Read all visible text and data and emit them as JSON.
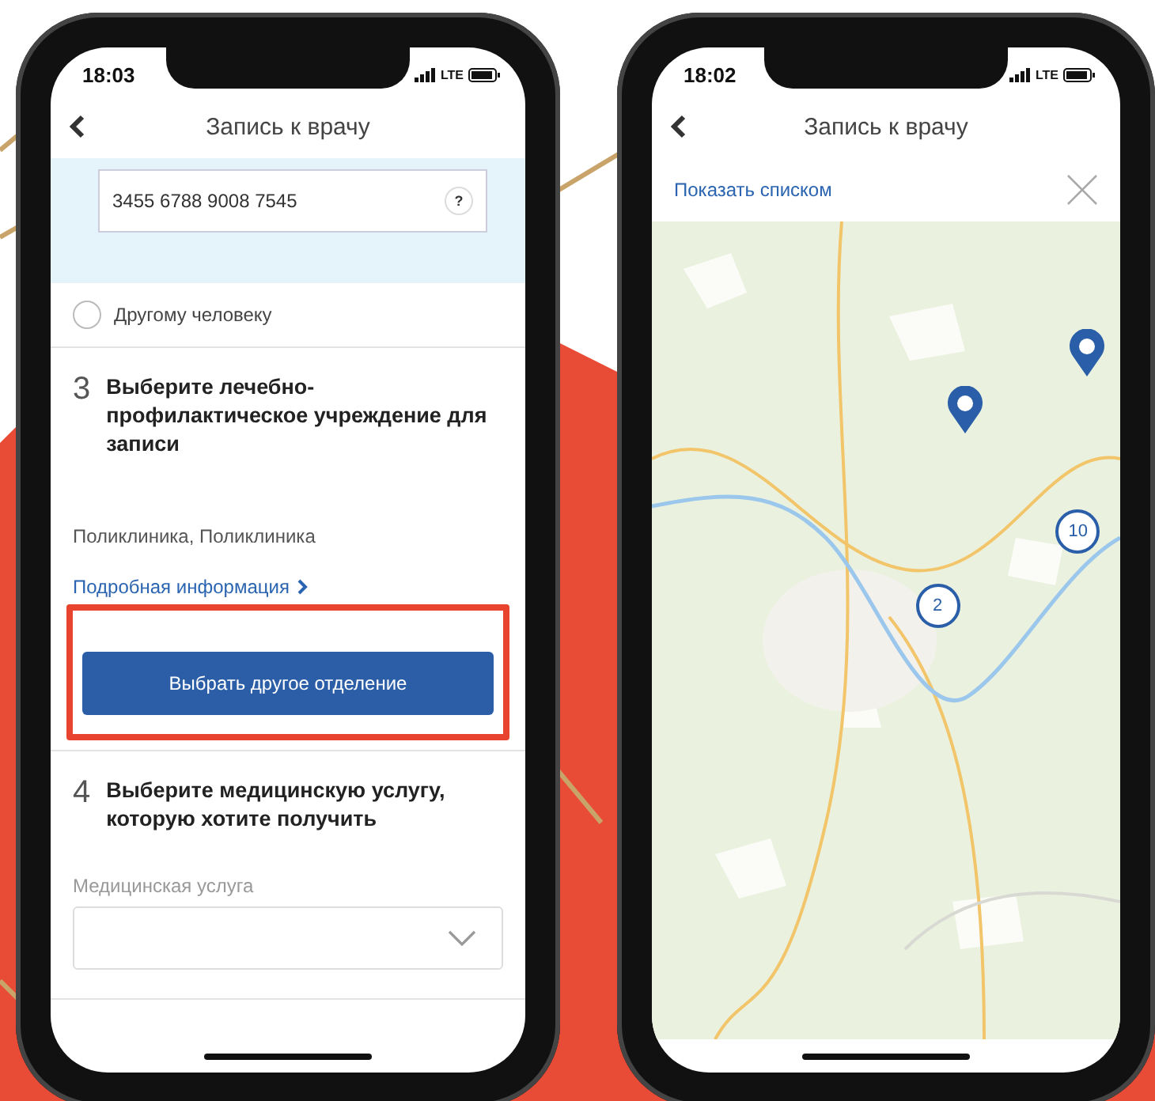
{
  "left_phone": {
    "status_bar": {
      "time": "18:03",
      "network": "LTE"
    },
    "header": {
      "title": "Запись к врачу"
    },
    "card_field": {
      "value": "3455 6788 9008 7545",
      "help": "?"
    },
    "recipient_option": {
      "label": "Другому человеку",
      "selected": false
    },
    "step_3": {
      "number": "3",
      "title": "Выберите лечебно-профилактическое учреждение для записи",
      "facility": "Поликлиника, Поликлиника",
      "details_link": "Подробная информация",
      "button": "Выбрать другое отделение",
      "highlighted": true
    },
    "step_4": {
      "number": "4",
      "title": "Выберите медицинскую услугу, которую хотите получить",
      "field_label": "Медицинская услуга"
    }
  },
  "right_phone": {
    "status_bar": {
      "time": "18:02",
      "network": "LTE"
    },
    "header": {
      "title": "Запись к врачу"
    },
    "list_link": "Показать списком",
    "map": {
      "kind": "picture",
      "markers": [
        {
          "kind": "pin"
        },
        {
          "kind": "pin"
        },
        {
          "kind": "cluster",
          "count": "2"
        },
        {
          "kind": "cluster",
          "count": "10"
        }
      ]
    }
  }
}
